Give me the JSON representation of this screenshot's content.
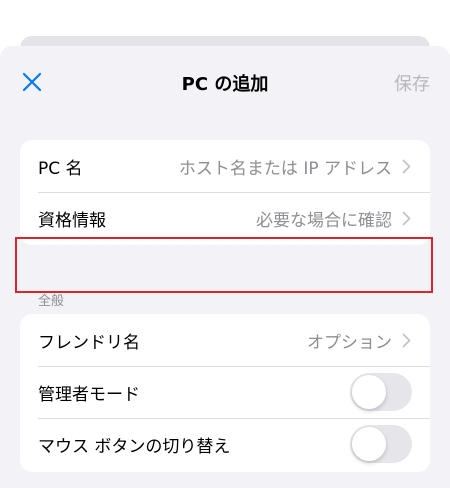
{
  "nav": {
    "title": "PC の追加",
    "save_label": "保存"
  },
  "connection": {
    "pc_name_label": "PC 名",
    "pc_name_placeholder": "ホスト名または IP アドレス",
    "credentials_label": "資格情報",
    "credentials_value": "必要な場合に確認"
  },
  "general": {
    "header": "全般",
    "friendly_name_label": "フレンドリ名",
    "friendly_name_value": "オプション",
    "admin_mode_label": "管理者モード",
    "admin_mode_on": false,
    "swap_mouse_label": "マウス ボタンの切り替え",
    "swap_mouse_on": false
  },
  "colors": {
    "accent": "#007aff",
    "highlight": "#d9262c"
  }
}
